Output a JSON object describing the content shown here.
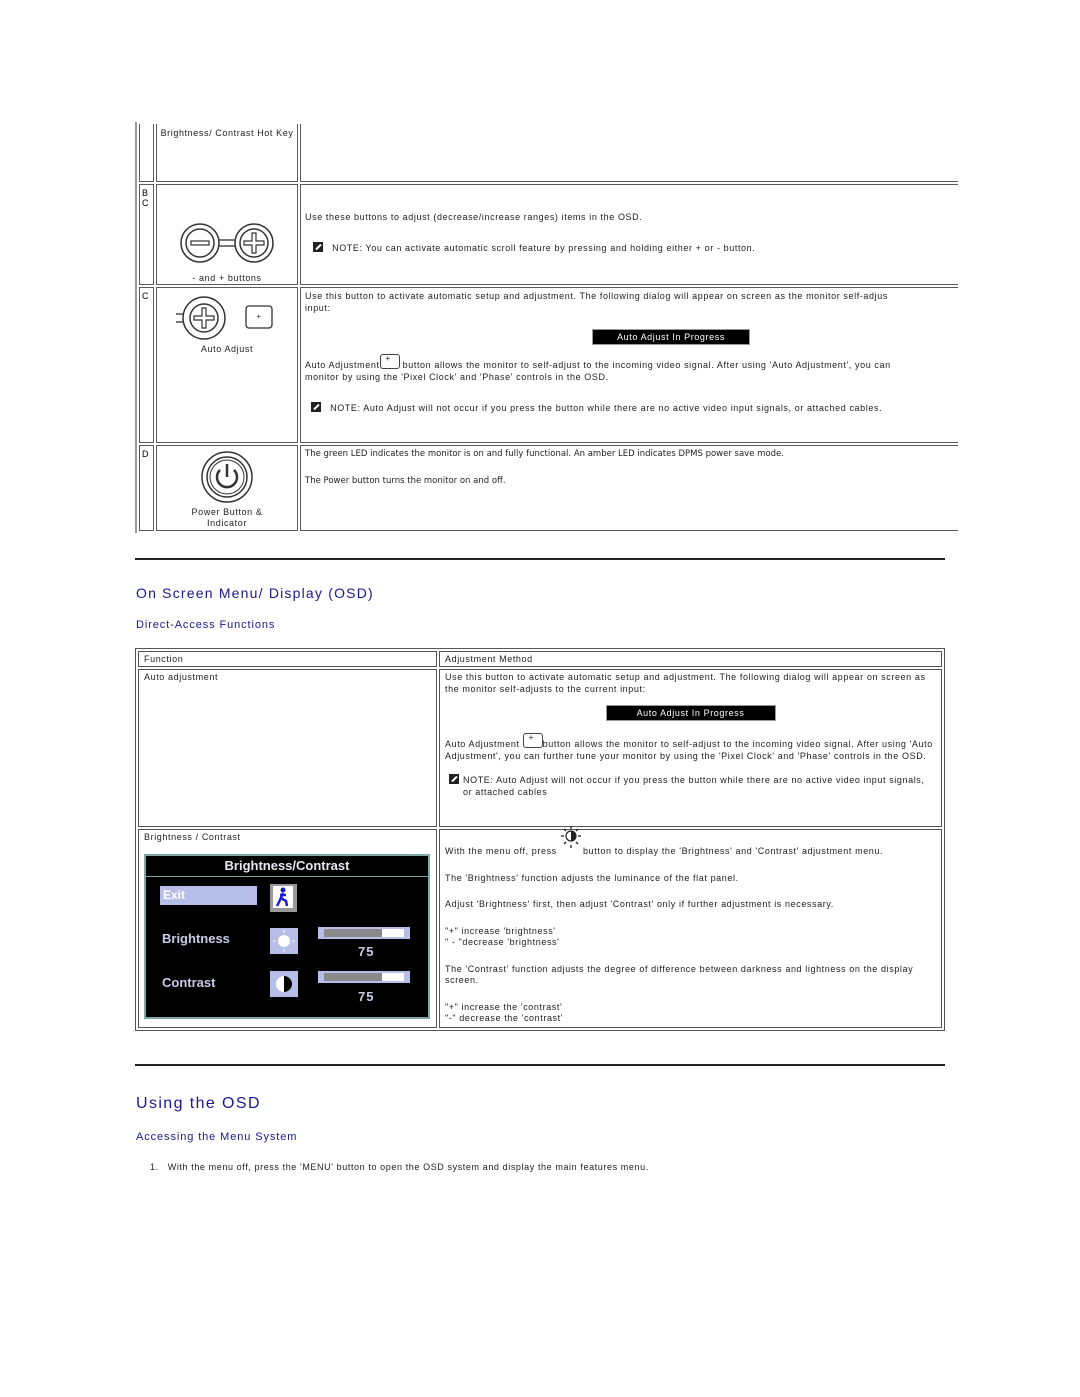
{
  "buttons_table": {
    "rows": [
      {
        "letter": "",
        "caption": "Brightness/ Contrast Hot Key",
        "icon": "brightness-contrast-hotkey",
        "desc": []
      },
      {
        "letter": "B\nC",
        "caption": "- and + buttons",
        "icon": "minus-plus-buttons",
        "desc": [
          "Use these buttons to adjust (decrease/increase ranges) items in the OSD."
        ],
        "note": "NOTE: You can activate automatic scroll feature by pressing and holding either + or - button."
      },
      {
        "letter": "C",
        "caption": "Auto Adjust",
        "icon": "auto-adjust-button",
        "desc": [
          "Use this button to activate automatic setup and adjustment. The following dialog will appear on screen as the monitor self-adjus",
          "input:"
        ],
        "dialog": "Auto Adjust In Progress",
        "desc2a": "Auto Adjustment",
        "desc2b": " button allows the monitor to self-adjust to the incoming video signal. After using 'Auto Adjustment', you can",
        "desc2c": "monitor by using the 'Pixel Clock' and 'Phase' controls in the OSD.",
        "note": "NOTE: Auto Adjust will not occur if you press the button while there are no active video input signals, or attached cables."
      },
      {
        "letter": "D",
        "caption_line1": "Power Button &",
        "caption_line2": "Indicator",
        "icon": "power-button",
        "desc": [
          "The green LED indicates the monitor is on and fully functional. An amber LED indicates DPMS power save mode.",
          "The Power button turns the monitor on and off."
        ]
      }
    ]
  },
  "osd_section": {
    "title": "On Screen Menu/ Display (OSD)",
    "subtitle": "Direct-Access Functions",
    "table": {
      "headers": [
        "Function",
        "Adjustment Method"
      ],
      "auto": {
        "function": "Auto adjustment",
        "p1": "Use this button to activate automatic setup and adjustment. The following dialog will appear on screen as the monitor self-adjusts to the current input:",
        "dialog": "Auto Adjust In Progress",
        "p2a": "Auto Adjustment ",
        "p2b": "button allows the monitor to self-adjust to the incoming video signal. After using 'Auto Adjustment', you can further tune your monitor by using the 'Pixel Clock' and 'Phase' controls in the OSD.",
        "note": "NOTE: Auto Adjust will not occur if you press the button while there are no active video input signals, or attached cables"
      },
      "brightness": {
        "function": "Brightness /  Contrast",
        "p1a": "With the menu off, press ",
        "p1b": " button to display the 'Brightness' and 'Contrast' adjustment menu.",
        "p2": "The 'Brightness' function adjusts the luminance of the flat panel.",
        "p3": "Adjust 'Brightness' first, then adjust 'Contrast' only if further adjustment is necessary.",
        "p4a": "\"+\" increase 'brightness'",
        "p4b": "\" - \"decrease 'brightness'",
        "p5": "The 'Contrast' function adjusts the degree of difference between darkness and lightness on the display screen.",
        "p6a": "\"+\" increase the 'contrast'",
        "p6b": "\"-\" decrease the 'contrast'",
        "osd": {
          "title": "Brightness/Contrast",
          "exit": "Exit",
          "brightness_label": "Brightness",
          "brightness_value": "75",
          "contrast_label": "Contrast",
          "contrast_value": "75",
          "bar_minus": "-",
          "bar_plus": "+"
        }
      }
    }
  },
  "using_section": {
    "title": "Using the OSD",
    "subtitle": "Accessing the Menu System",
    "steps": [
      "With the menu off, press the 'MENU' button to open the OSD system and display the main features menu."
    ]
  }
}
